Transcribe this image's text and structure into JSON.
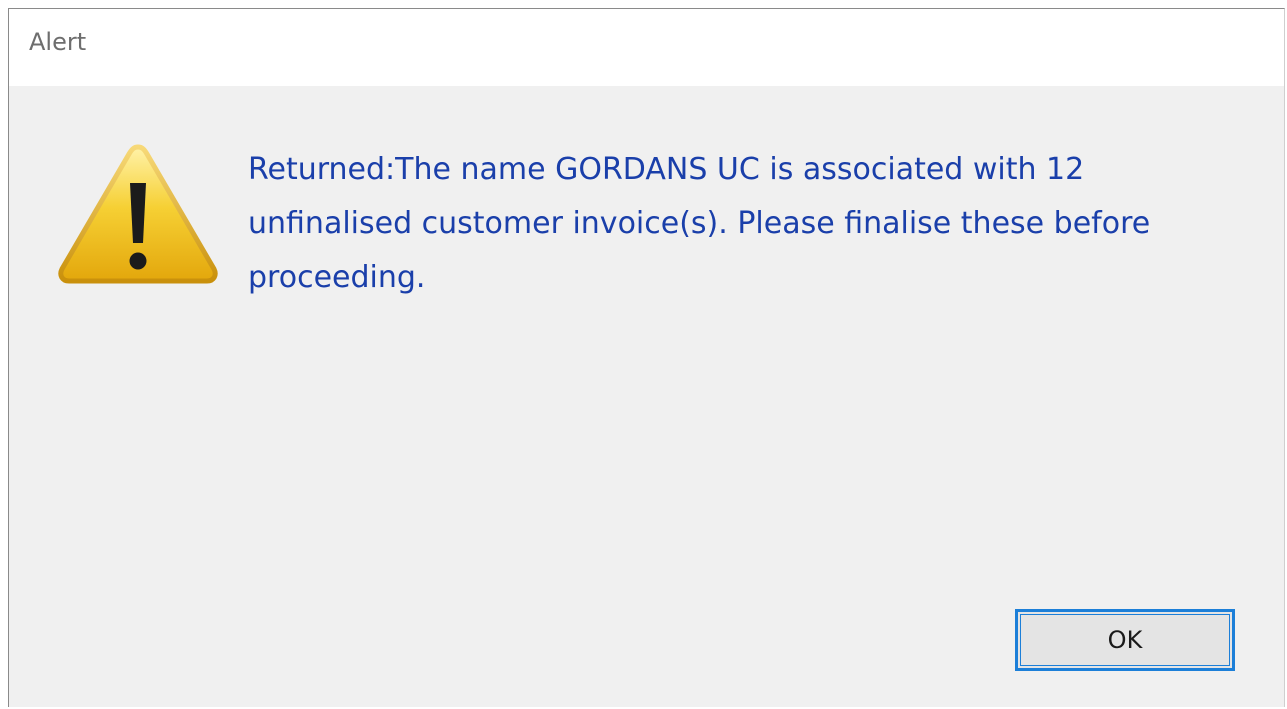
{
  "window": {
    "title": "Alert"
  },
  "message": {
    "text": "Returned:The name GORDANS UC is associated with 12 unfinalised customer invoice(s). Please finalise these before proceeding."
  },
  "icons": {
    "alert": "warning-icon"
  },
  "buttons": {
    "ok_label": "OK"
  },
  "colors": {
    "message_text": "#1a3faa",
    "button_focus_border": "#1c7fd8",
    "warning_fill": "#f2c21b",
    "dialog_background": "#f0f0f0"
  }
}
